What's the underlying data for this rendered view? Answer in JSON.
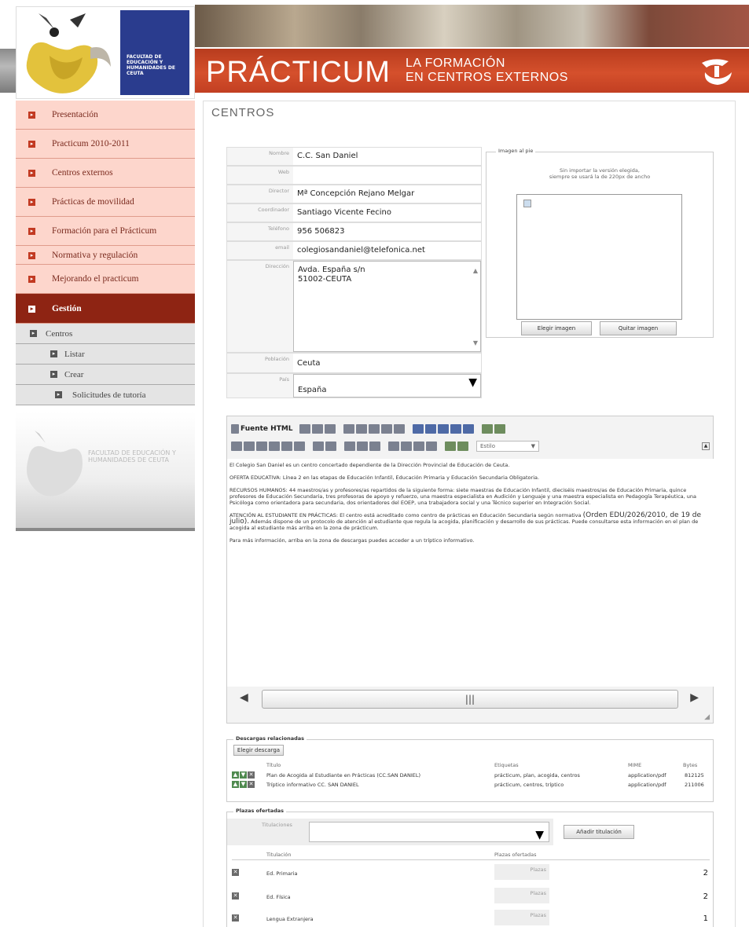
{
  "header": {
    "logo_text": "FACULTAD DE EDUCACIÓN Y HUMANIDADES DE CEUTA",
    "title_main": "PRÁCTICUM",
    "title_sub_line1": "LA FORMACIÓN",
    "title_sub_line2": "EN CENTROS EXTERNOS"
  },
  "sidebar": {
    "items": [
      {
        "label": "Presentación"
      },
      {
        "label": "Practicum 2010-2011"
      },
      {
        "label": "Centros externos"
      },
      {
        "label": "Prácticas de movilidad"
      },
      {
        "label": "Formación para el Prácticum"
      },
      {
        "label": "Normativa y regulación"
      },
      {
        "label": "Mejorando el practicum"
      },
      {
        "label": "Gestión"
      }
    ],
    "subitems": [
      {
        "label": "Centros"
      },
      {
        "label": "Listar"
      },
      {
        "label": "Crear"
      },
      {
        "label": "Solicitudes de tutoría"
      }
    ],
    "footer_text": "FACULTAD DE EDUCACIÓN Y HUMANIDADES DE CEUTA"
  },
  "section_title": "CENTROS",
  "form": {
    "nombre_label": "Nombre",
    "nombre_value": "C.C. San Daniel",
    "web_label": "Web",
    "web_value": "",
    "director_label": "Director",
    "director_value": "Mª Concepción Rejano Melgar",
    "coordinador_label": "Coordinador",
    "coordinador_value": "Santiago Vicente Fecino",
    "telefono_label": "Teléfono",
    "telefono_value": "956 506823",
    "email_label": "email",
    "email_value": "colegiosandaniel@telefonica.net",
    "direccion_label": "Dirección",
    "direccion_line1": "Avda. España s/n",
    "direccion_line2": "51002-CEUTA",
    "poblacion_label": "Población",
    "poblacion_value": "Ceuta",
    "pais_label": "País",
    "pais_value": "España"
  },
  "image_box": {
    "legend": "Imagen al pie",
    "note_line1": "Sin importar la versión elegida,",
    "note_line2": "siempre se usará la de 220px de ancho",
    "choose_button": "Elegir imagen",
    "remove_button": "Quitar imagen"
  },
  "editor": {
    "source_label": "Fuente HTML",
    "style_label": "Estilo",
    "p1": "El Colegio San Daniel es un centro concertado dependiente de la Dirección Provincial de Educación de Ceuta.",
    "p2": "OFERTA EDUCATIVA: Línea 2 en las etapas de Educación Infantil, Educación Primaria y Educación Secundaria Obligatoria.",
    "p3": "RECURSOS HUMANOS: 44 maestros/as y profesores/as repartidos de la siguiente forma: siete maestras de Educación Infantil, dieciséis maestros/as de Educación Primaria, quince profesores de Educación Secundaria, tres profesoras de apoyo y refuerzo, una maestra especialista en Audición y Lenguaje y una maestra especialista en Pedagogía Terapéutica, una Psicóloga como orientadora para secundaria, dos orientadores del EOEP, una trabajadora social y una Técnico superior en Integración Social.",
    "p4_a": "ATENCIÓN AL ESTUDIANTE EN PRÁCTICAS: El centro está acreditado como centro de prácticas en Educación Secundaria según normativa",
    "p4_b": "(Orden EDU/2026/2010, de 19 de julio).",
    "p4_c": "Además dispone de un protocolo de atención al estudiante que regula la acogida, planificación y desarrollo de sus prácticas. Puede consultarse esta información en el plan de acogida al estudiante más arriba en la zona de prácticum.",
    "p5": "Para más información, arriba en la zona de descargas puedes acceder a un tríptico informativo."
  },
  "downloads": {
    "legend": "Descargas relacionadas",
    "choose_button": "Elegir descarga",
    "headers": [
      "Título",
      "Etiquetas",
      "MIME",
      "Bytes"
    ],
    "rows": [
      {
        "title": "Plan de Acogida al Estudiante en Prácticas (CC.SAN DANIEL)",
        "tags": "prácticum, plan, acogida, centros",
        "mime": "application/pdf",
        "bytes": "812125"
      },
      {
        "title": "Tríptico informativo CC. SAN DANIEL",
        "tags": "prácticum, centros, tríptico",
        "mime": "application/pdf",
        "bytes": "211006"
      }
    ]
  },
  "plazas": {
    "legend": "Plazas ofertadas",
    "titulaciones_label": "Titulaciones",
    "add_button": "Añadir titulación",
    "headers": [
      "Titulación",
      "Plazas ofertadas"
    ],
    "placeholder": "Plazas",
    "rows": [
      {
        "titulacion": "Ed. Primaria",
        "plazas": "2"
      },
      {
        "titulacion": "Ed. Física",
        "plazas": "2"
      },
      {
        "titulacion": "Lengua Extranjera",
        "plazas": "1"
      }
    ]
  }
}
